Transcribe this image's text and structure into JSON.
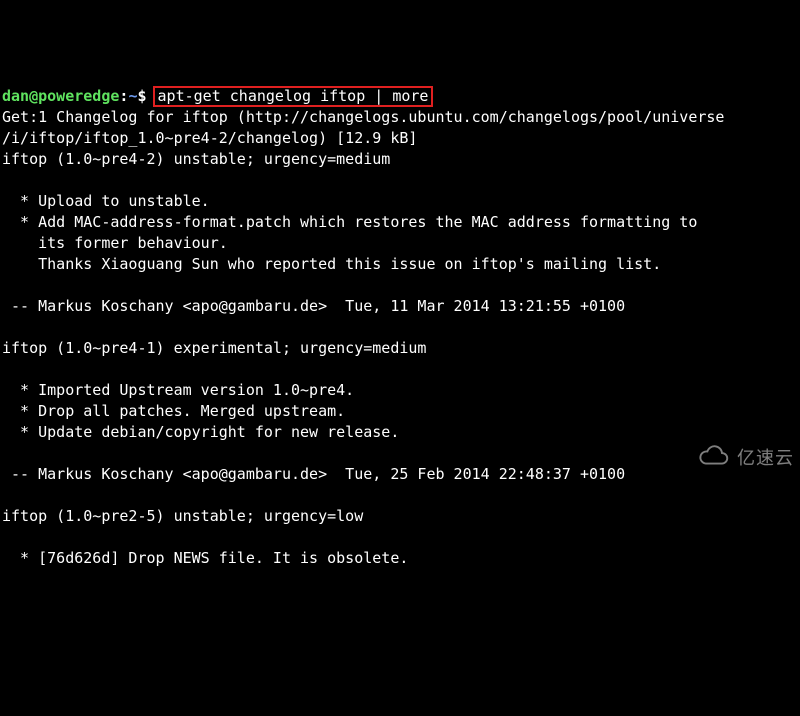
{
  "prompt": {
    "user_host": "dan@poweredge",
    "colon": ":",
    "path": "~",
    "dollar": "$ ",
    "command": "apt-get changelog iftop | more"
  },
  "lines": {
    "l0": "Get:1 Changelog for iftop (http://changelogs.ubuntu.com/changelogs/pool/universe",
    "l1": "/i/iftop/iftop_1.0~pre4-2/changelog) [12.9 kB]",
    "l2": "iftop (1.0~pre4-2) unstable; urgency=medium",
    "l3": "",
    "l4": "  * Upload to unstable.",
    "l5": "  * Add MAC-address-format.patch which restores the MAC address formatting to",
    "l6": "    its former behaviour.",
    "l7": "    Thanks Xiaoguang Sun who reported this issue on iftop's mailing list.",
    "l8": "",
    "l9": " -- Markus Koschany <apo@gambaru.de>  Tue, 11 Mar 2014 13:21:55 +0100",
    "l10": "",
    "l11": "iftop (1.0~pre4-1) experimental; urgency=medium",
    "l12": "",
    "l13": "  * Imported Upstream version 1.0~pre4.",
    "l14": "  * Drop all patches. Merged upstream.",
    "l15": "  * Update debian/copyright for new release.",
    "l16": "",
    "l17": " -- Markus Koschany <apo@gambaru.de>  Tue, 25 Feb 2014 22:48:37 +0100",
    "l18": "",
    "l19": "iftop (1.0~pre2-5) unstable; urgency=low",
    "l20": "",
    "l21": "  * [76d626d] Drop NEWS file. It is obsolete."
  },
  "watermark": {
    "text": "亿速云"
  }
}
